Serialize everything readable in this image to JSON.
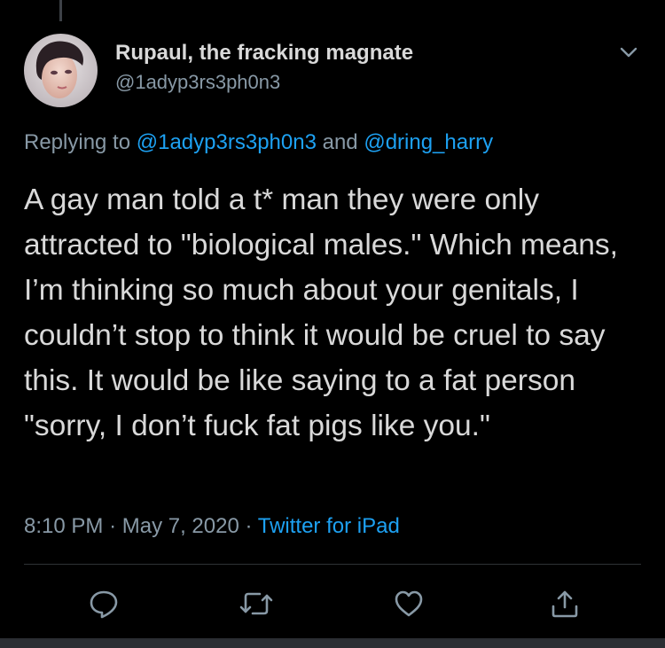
{
  "tweet": {
    "display_name": "Rupaul, the fracking magnate",
    "handle": "@1adyp3rs3ph0n3",
    "replying_prefix": "Replying to ",
    "reply_to_1": "@1adyp3rs3ph0n3",
    "reply_joiner": " and ",
    "reply_to_2": "@dring_harry",
    "text": "A gay man told a t* man they were only attracted to \"biological males.\" Which means, I’m thinking so much about your genitals, I couldn’t stop to think it would be cruel to say this. It would be like saying to a fat person \"sorry, I don’t fuck fat pigs like you.\"",
    "time": "8:10 PM",
    "separator": "·",
    "date": "May 7, 2020",
    "source": "Twitter for iPad"
  },
  "icons": {
    "menu": "chevron-down-icon",
    "reply": "reply-icon",
    "retweet": "retweet-icon",
    "like": "heart-icon",
    "share": "share-icon"
  },
  "colors": {
    "background": "#000000",
    "text": "#d9d9d9",
    "muted": "#8899a6",
    "link": "#1da1f2",
    "divider": "#2f3336"
  }
}
